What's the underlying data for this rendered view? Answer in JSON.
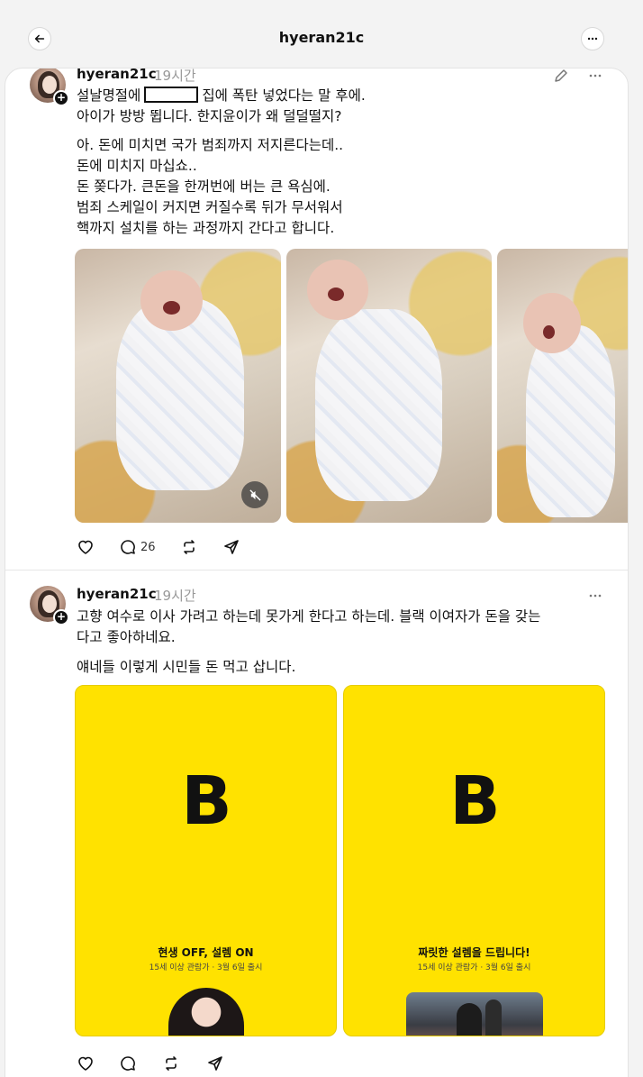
{
  "header": {
    "title": "hyeran21c"
  },
  "posts": [
    {
      "username": "hyeran21c",
      "time": "19시간",
      "text_line1_pre": "설날명절에",
      "text_line1_post": "집에 폭탄 넣었다는 말 후에.",
      "text_line2": "아이가 방방 뜁니다. 한지윤이가 왜 덜덜떨지?",
      "paragraph2": [
        "아. 돈에 미치면 국가 범죄까지 저지른다는데..",
        "돈에 미치지 마십쇼..",
        "돈 쫒다가. 큰돈을 한꺼번에 버는 큰 욕심에.",
        "범죄 스케일이 커지면 커질수록 뒤가 무서워서",
        "핵까지 설치를 하는 과정까지 간다고 합니다."
      ],
      "reply_count": "26",
      "icons": [
        "edit-icon",
        "more-icon",
        "mute-icon",
        "heart-icon",
        "comment-icon",
        "repost-icon",
        "share-icon"
      ]
    },
    {
      "username": "hyeran21c",
      "time": "19시간",
      "text_lines": [
        "고향 여수로 이사 가려고 하는데 못가게 한다고 하는데. 블랙 이여자가 돈을 갖는",
        "다고 좋아하네요."
      ],
      "paragraph2": "얘네들 이렇게 시민들 돈 먹고 삽니다.",
      "ads": [
        {
          "logo": "B",
          "headline": "현생 OFF, 설렘 ON",
          "sub": "15세 이상 관람가 · 3월 6일 출시"
        },
        {
          "logo": "B",
          "headline": "짜릿한 설렘을 드립니다!",
          "sub": "15세 이상 관람가 · 3월 6일 출시"
        }
      ]
    }
  ],
  "colors": {
    "ad_yellow": "#ffe200",
    "muted_text": "#999999"
  }
}
